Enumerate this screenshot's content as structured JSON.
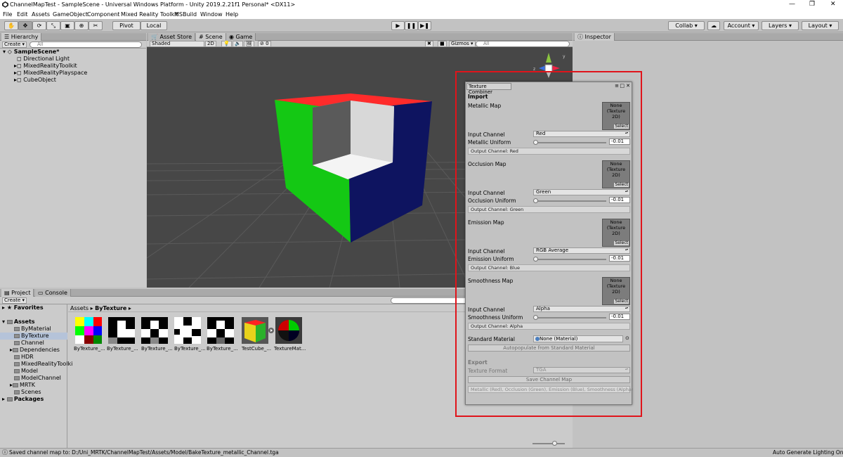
{
  "window": {
    "title": "ChannelMapTest - SampleScene - Universal Windows Platform - Unity 2019.2.21f1 Personal* <DX11>",
    "controls": [
      "—",
      "❐",
      "✕"
    ]
  },
  "menu": [
    "File",
    "Edit",
    "Assets",
    "GameObject",
    "Component",
    "Mixed Reality Toolkit",
    "MSBuild",
    "Window",
    "Help"
  ],
  "toolbar": {
    "pivot": "Pivot",
    "local": "Local",
    "collab": "Collab ▾",
    "account": "Account",
    "layers": "Layers",
    "layout": "Layout"
  },
  "hierarchy": {
    "tab": "Hierarchy",
    "create": "Create ▾",
    "search_placeholder": "All",
    "scene": "SampleScene*",
    "items": [
      "Directional Light",
      "MixedRealityToolkit",
      "MixedRealityPlayspace",
      "CubeObject"
    ]
  },
  "scene_tabs": [
    "Asset Store",
    "Scene",
    "Game"
  ],
  "scene_bar": {
    "shading": "Shaded",
    "mode2d": "2D",
    "gizmos": "Gizmos ▾",
    "search_placeholder": "All",
    "hidden_count": "0"
  },
  "inspector": {
    "tab": "Inspector"
  },
  "project": {
    "tabs": [
      "Project",
      "Console"
    ],
    "create": "Create ▾",
    "breadcrumb": [
      "Assets",
      "ByTexture"
    ],
    "tree": [
      {
        "label": "Favorites",
        "bold": true
      },
      {
        "label": "Assets",
        "bold": true
      },
      {
        "label": "ByMaterial"
      },
      {
        "label": "ByTexture",
        "selected": true
      },
      {
        "label": "Channel"
      },
      {
        "label": "Dependencies"
      },
      {
        "label": "HDR"
      },
      {
        "label": "MixedRealityToolki"
      },
      {
        "label": "Model"
      },
      {
        "label": "ModelChannel"
      },
      {
        "label": "MRTK"
      },
      {
        "label": "Scenes"
      },
      {
        "label": "Packages",
        "bold": true
      }
    ],
    "assets": [
      "ByTexture_...",
      "ByTexture_...",
      "ByTexture_...",
      "ByTexture_...",
      "ByTexture_...",
      "TestCube_...",
      "TextureMat..."
    ]
  },
  "texture_combiner": {
    "title": "Texture Combiner",
    "import_header": "Import",
    "slot_none": "None",
    "slot_type": "(Texture 2D)",
    "slot_select": "Select",
    "maps": [
      {
        "label": "Metallic Map",
        "channel_label": "Input Channel",
        "channel": "Red",
        "uniform_label": "Metallic Uniform",
        "uniform": "-0.01",
        "output": "Output Channel: Red"
      },
      {
        "label": "Occlusion Map",
        "channel_label": "Input Channel",
        "channel": "Green",
        "uniform_label": "Occlusion Uniform",
        "uniform": "-0.01",
        "output": "Output Channel: Green"
      },
      {
        "label": "Emission Map",
        "channel_label": "Input Channel",
        "channel": "RGB Average",
        "uniform_label": "Emission Uniform",
        "uniform": "-0.01",
        "output": "Output Channel: Blue"
      },
      {
        "label": "Smoothness Map",
        "channel_label": "Input Channel",
        "channel": "Alpha",
        "uniform_label": "Smoothness Uniform",
        "uniform": "-0.01",
        "output": "Output Channel: Alpha"
      }
    ],
    "standard_material_label": "Standard Material",
    "standard_material_value": "None (Material)",
    "autopopulate": "Autopopulate from Standard Material",
    "export_header": "Export",
    "texture_format_label": "Texture Format",
    "texture_format": "TGA",
    "save": "Save Channel Map",
    "summary": "Metallic (Red), Occlusion (Green), Emission (Blue), Smoothness (Alpha)"
  },
  "status": {
    "message": "Saved channel map to: D:/Uni_MRTK/ChannelMapTest/Assets/Model/BakeTexture_metallic_Channel.tga",
    "right": "Auto Generate Lighting On"
  },
  "colors": {
    "highlight": "#e0141b",
    "cube_red": "#ff2b2b",
    "cube_green": "#14c814",
    "cube_blue": "#0e1460"
  }
}
